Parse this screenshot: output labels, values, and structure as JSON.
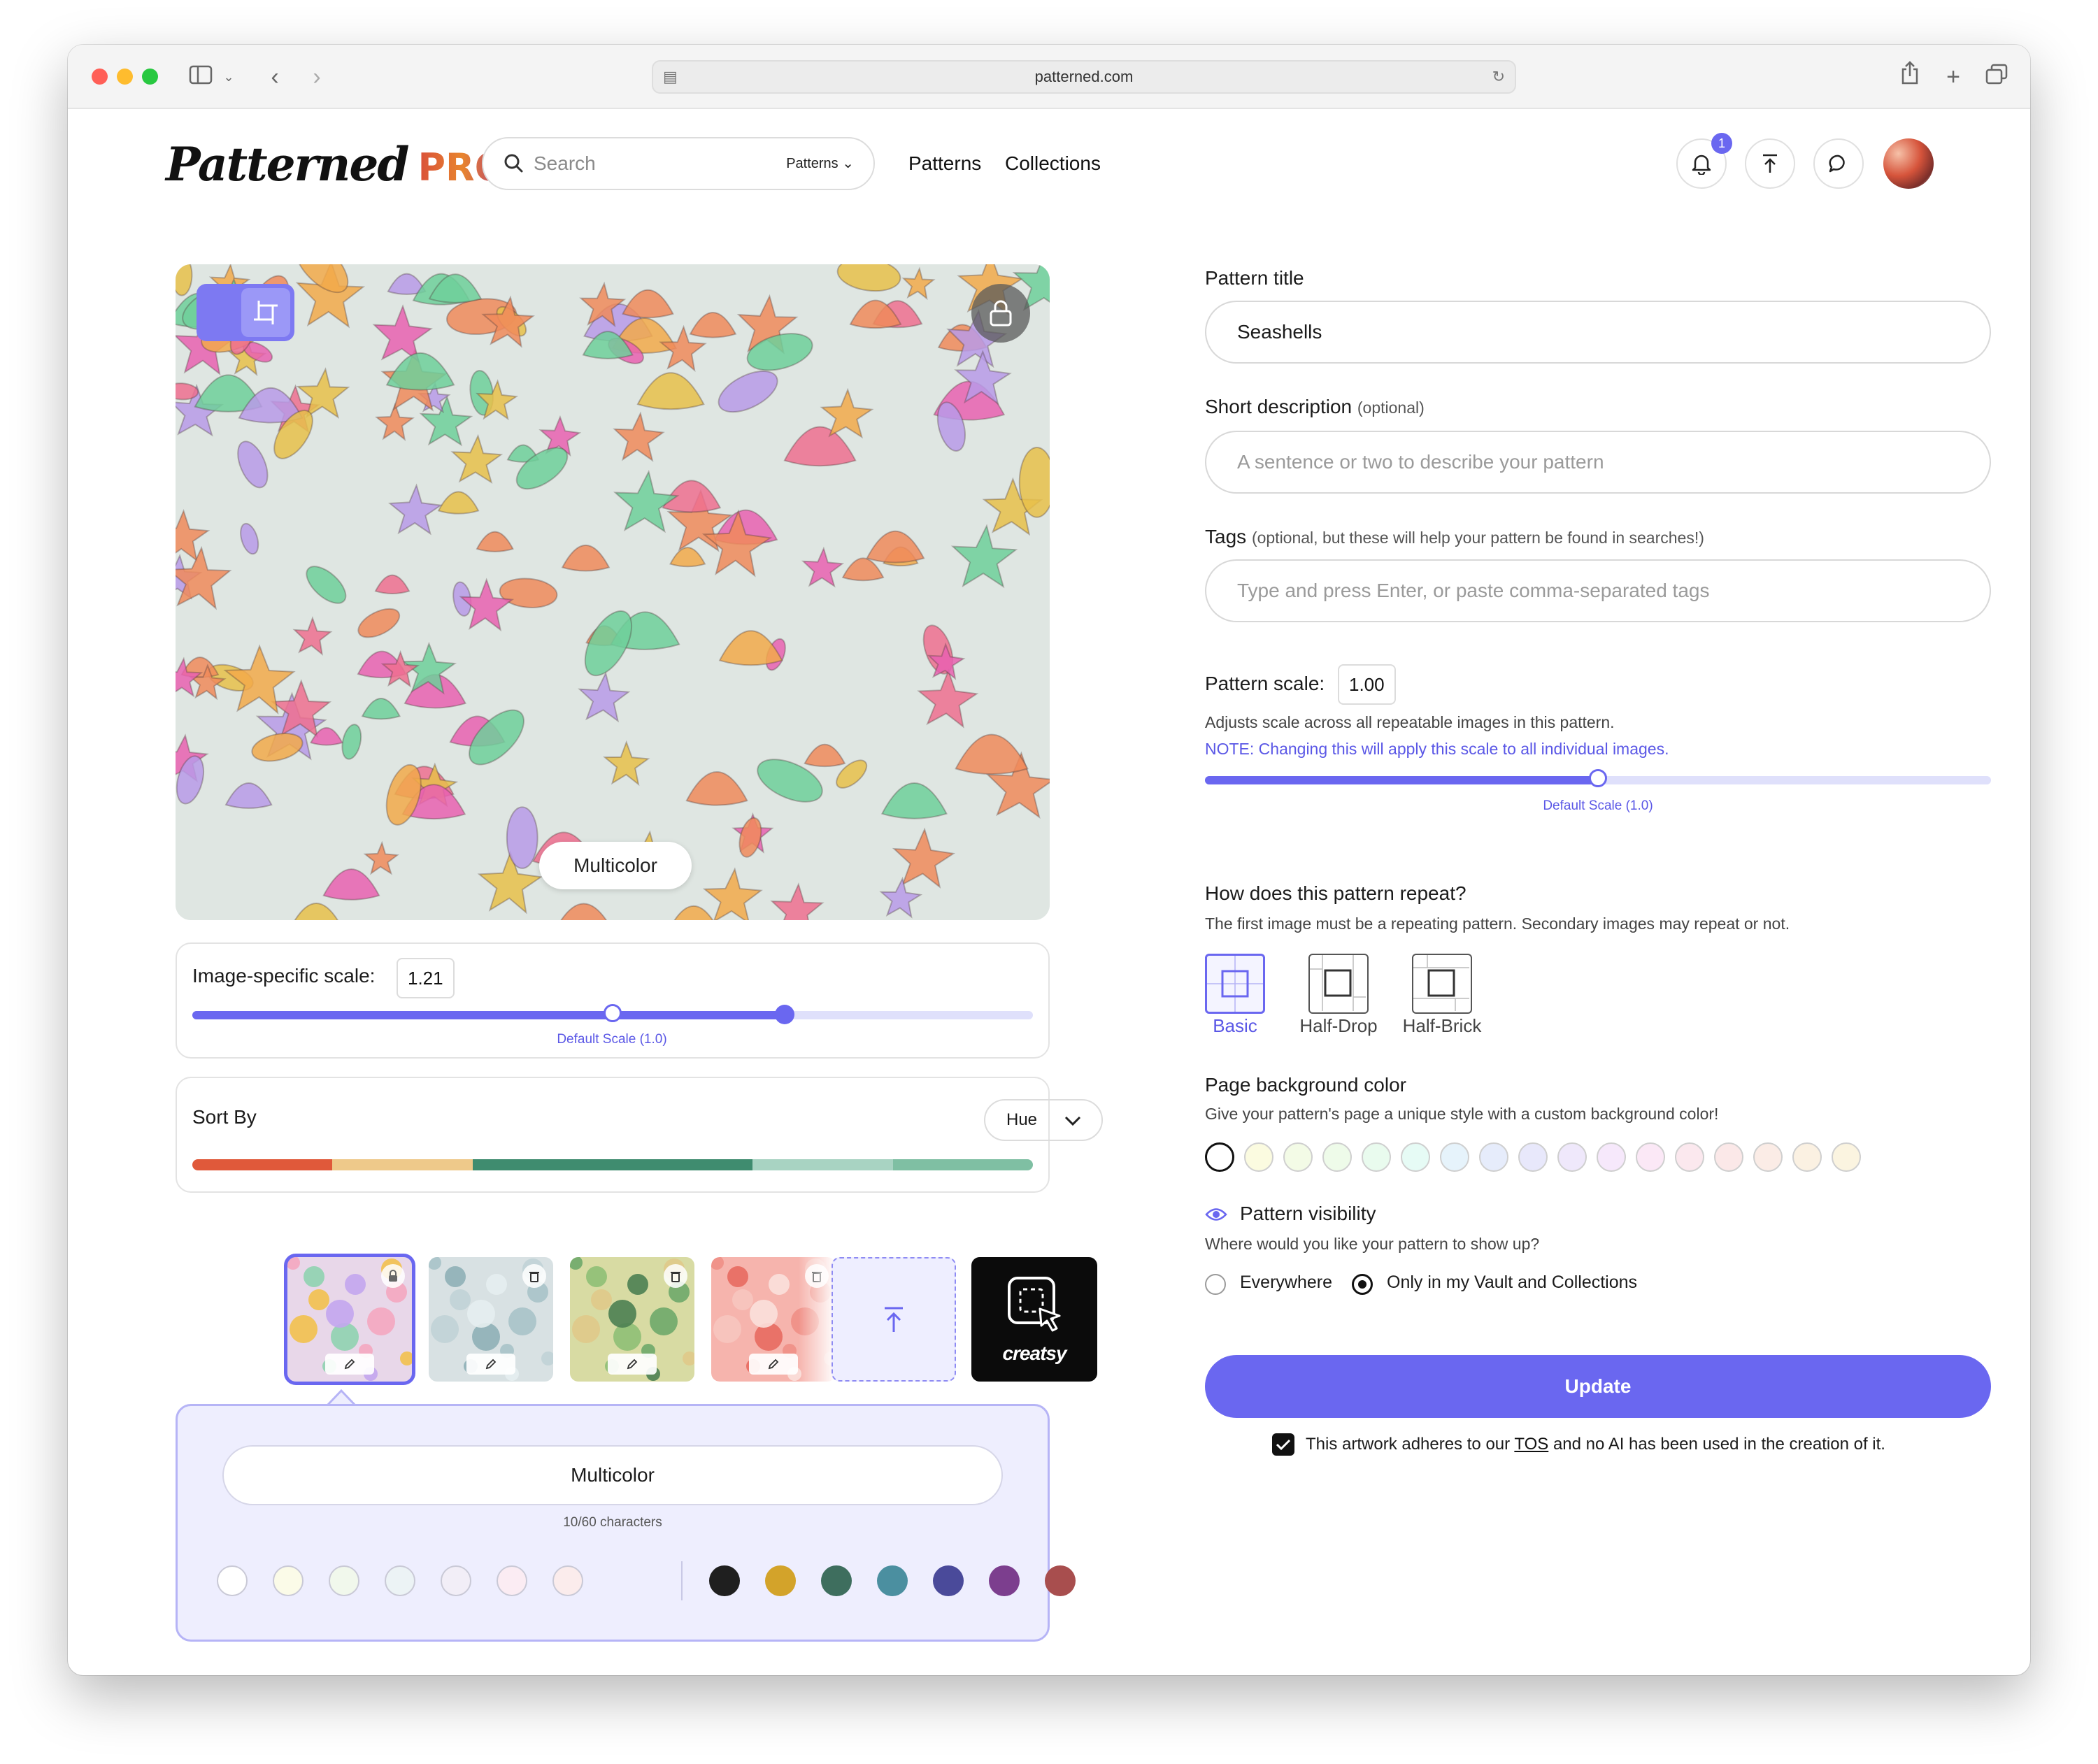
{
  "browser": {
    "url": "patterned.com"
  },
  "header": {
    "logo_script": "Patterned",
    "logo_pro": "PRO",
    "search_placeholder": "Search",
    "search_scope": "Patterns",
    "nav": [
      "Patterns",
      "Collections"
    ],
    "notification_count": "1"
  },
  "preview": {
    "colorway_label": "Multicolor",
    "pattern_colors": [
      "#ef6f8f",
      "#f08a5a",
      "#e7c04a",
      "#6fcf9a",
      "#b99ae8",
      "#e960b0",
      "#f2a94a"
    ]
  },
  "image_scale": {
    "label": "Image-specific scale:",
    "value": "1.21",
    "default_label": "Default Scale (1.0)",
    "default_position": 0.5,
    "current_position": 0.705
  },
  "sort": {
    "label": "Sort By",
    "selected": "Hue",
    "hue_colors": [
      "#e0593a",
      "#eec98a",
      "#3f8c6f",
      "#3f8c6f",
      "#a8d3c2",
      "#7fbfa3"
    ]
  },
  "thumbnails": [
    {
      "name": "thumb-multicolor",
      "bg": "#e8d7e9",
      "selected": true,
      "locked": true
    },
    {
      "name": "thumb-grey",
      "bg": "#d8e1e3",
      "selected": false,
      "locked": false
    },
    {
      "name": "thumb-green",
      "bg": "#d8dba3",
      "selected": false,
      "locked": false
    },
    {
      "name": "thumb-coral",
      "bg": "#f6b4ad",
      "selected": false,
      "locked": false
    }
  ],
  "creatsy_label": "creatsy",
  "colorway": {
    "name": "Multicolor",
    "char_count": "10/60 characters",
    "light_swatches": [
      "#ffffff",
      "#fbfbe8",
      "#f1f8ec",
      "#ecf3f5",
      "#f2eef7",
      "#fbecf3",
      "#fbecec"
    ],
    "dark_swatches": [
      "#1f1f1f",
      "#d3a32a",
      "#3e6e5e",
      "#4b8fa0",
      "#4a4a9a",
      "#7c3e8e",
      "#a84e4e"
    ]
  },
  "form": {
    "title_label": "Pattern title",
    "title_value": "Seashells",
    "desc_label": "Short description",
    "desc_optional": "(optional)",
    "desc_placeholder": "A sentence or two to describe your pattern",
    "tags_label": "Tags",
    "tags_optional": "(optional, but these will help your pattern be found in searches!)",
    "tags_placeholder": "Type and press Enter, or paste comma-separated tags",
    "scale_label": "Pattern scale:",
    "scale_value": "1.00",
    "scale_help": "Adjusts scale across all repeatable images in this pattern.",
    "scale_note": "NOTE: Changing this will apply this scale to all individual images.",
    "scale_default_label": "Default Scale (1.0)",
    "scale_position": 0.5,
    "repeat_label": "How does this pattern repeat?",
    "repeat_help": "The first image must be a repeating pattern. Secondary images may repeat or not.",
    "repeat_options": [
      "Basic",
      "Half-Drop",
      "Half-Brick"
    ],
    "bg_label": "Page background color",
    "bg_help": "Give your pattern's page a unique style with a custom background color!",
    "bg_swatches": [
      "#ffffff",
      "#fbfbe0",
      "#f3fbe6",
      "#eefbe9",
      "#e9fbee",
      "#e6fbf5",
      "#e6f3fb",
      "#e6ecfb",
      "#e8e8fb",
      "#efe8fb",
      "#f6e8fb",
      "#fbe8f6",
      "#fbe8ee",
      "#fbe8e8",
      "#fbece6",
      "#fbf1e2",
      "#fbf4e0"
    ],
    "visibility_label": "Pattern visibility",
    "visibility_help": "Where would you like your pattern to show up?",
    "visibility_options": [
      "Everywhere",
      "Only in my Vault and Collections"
    ],
    "update_label": "Update",
    "tos_pre": "This artwork adheres to our",
    "tos_link": "TOS",
    "tos_post": "and no AI has been used in the creation of it."
  }
}
